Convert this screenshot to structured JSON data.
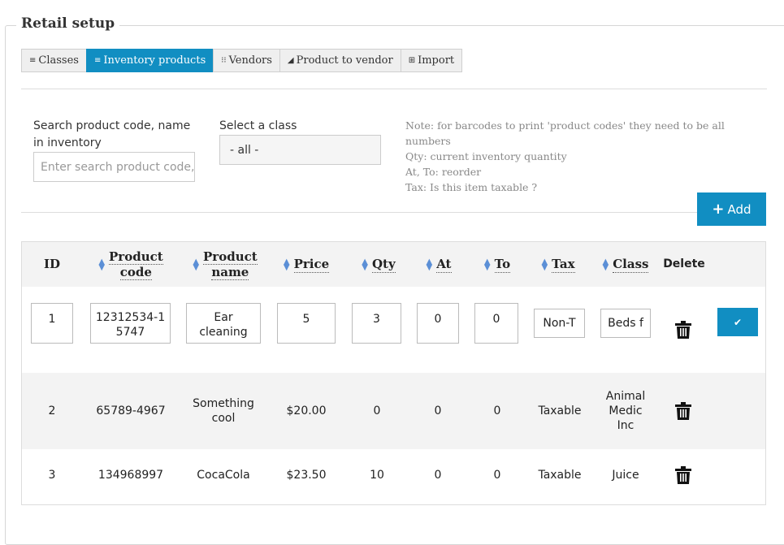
{
  "legend": "Retail setup",
  "tabs": [
    {
      "icon": "≡",
      "label": "Classes"
    },
    {
      "icon": "≡",
      "label": "Inventory products"
    },
    {
      "icon": "⁝⁝",
      "label": "Vendors"
    },
    {
      "icon": "◢",
      "label": "Product to vendor"
    },
    {
      "icon": "⊞",
      "label": "Import"
    }
  ],
  "active_tab": "Inventory products",
  "search": {
    "label": "Search product code, name in inventory",
    "placeholder": "Enter search product code, name"
  },
  "class_select": {
    "label": "Select a class",
    "value": "- all -"
  },
  "note": {
    "line1": "Note: for barcodes to print 'product codes' they need to be all numbers",
    "line2": "Qty: current inventory quantity",
    "line3": "At, To: reorder",
    "line4": "Tax: Is this item taxable ?"
  },
  "add_button": "Add",
  "columns": {
    "id": "ID",
    "product_code_1": "Product",
    "product_code_2": "code",
    "product_name_1": "Product",
    "product_name_2": "name",
    "price": "Price",
    "qty": "Qty",
    "at": "At",
    "to": "To",
    "tax": "Tax",
    "class": "Class",
    "delete": "Delete"
  },
  "edit_row": {
    "id": "1",
    "product_code": "12312534-15747",
    "product_code_l1": "12312534-1",
    "product_code_l2": "5747",
    "product_name_l1": "Ear",
    "product_name_l2": "cleaning",
    "price": "5",
    "qty": "3",
    "at": "0",
    "to": "0",
    "tax": "Non-T",
    "class": "Beds f"
  },
  "rows": [
    {
      "id": "2",
      "product_code": "65789-4967",
      "product_name_l1": "Something",
      "product_name_l2": "cool",
      "price": "$20.00",
      "qty": "0",
      "at": "0",
      "to": "0",
      "tax": "Taxable",
      "class_l1": "Animal",
      "class_l2": "Medic",
      "class_l3": "Inc"
    },
    {
      "id": "3",
      "product_code": "134968997",
      "product_name": "CocaCola",
      "price": "$23.50",
      "qty": "10",
      "at": "0",
      "to": "0",
      "tax": "Taxable",
      "class": "Juice"
    }
  ],
  "colors": {
    "accent": "#118ec2",
    "sort_icon": "#5b8fd6",
    "header_bg": "#f3f3f3"
  }
}
